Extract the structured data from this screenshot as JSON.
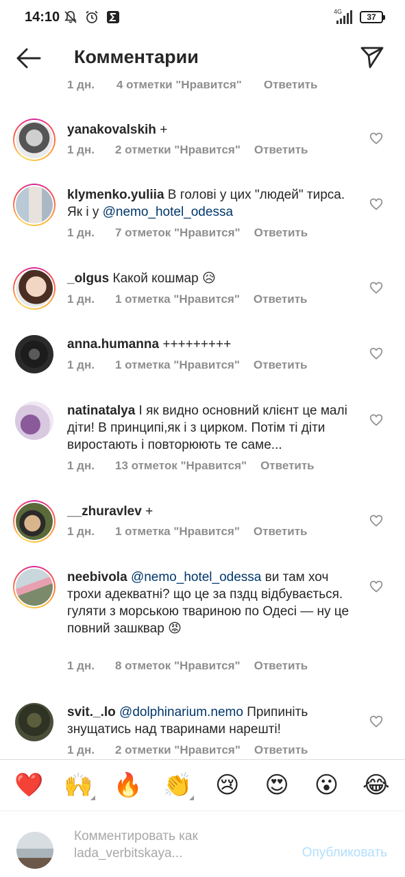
{
  "status_bar": {
    "time": "14:10",
    "network": "4G",
    "battery": "37"
  },
  "header": {
    "title": "Комментарии"
  },
  "partial_row": {
    "time": "1 дн.",
    "likes": "4 отметки \"Нравится\"",
    "reply": "Ответить"
  },
  "comments": [
    {
      "username": "yanakovalskih",
      "text_before": " +",
      "mention": "",
      "text_after": "",
      "time": "1 дн.",
      "likes": "2 отметки \"Нравится\"",
      "reply": "Ответить"
    },
    {
      "username": "klymenko.yuliia",
      "text_before": " В голові у цих \"людей\" тирса. Як і у ",
      "mention": "@nemo_hotel_odessa",
      "text_after": "",
      "time": "1 дн.",
      "likes": "7 отметок \"Нравится\"",
      "reply": "Ответить"
    },
    {
      "username": "_olgus",
      "text_before": " Какой кошмар 😥",
      "mention": "",
      "text_after": "",
      "time": "1 дн.",
      "likes": "1 отметка \"Нравится\"",
      "reply": "Ответить"
    },
    {
      "username": "anna.humanna",
      "text_before": " +++++++++",
      "mention": "",
      "text_after": "",
      "time": "1 дн.",
      "likes": "1 отметка \"Нравится\"",
      "reply": "Ответить"
    },
    {
      "username": "natinatalya",
      "text_before": " І як видно основний клієнт це малі діти! В принципі,як і з цирком. Потім ті діти виростають і повторюють те саме...",
      "mention": "",
      "text_after": "",
      "time": "1 дн.",
      "likes": "13 отметок \"Нравится\"",
      "reply": "Ответить"
    },
    {
      "username": "__zhuravlev",
      "text_before": " +",
      "mention": "",
      "text_after": "",
      "time": "1 дн.",
      "likes": "1 отметка \"Нравится\"",
      "reply": "Ответить"
    },
    {
      "username": "neebivola",
      "text_before": " ",
      "mention": "@nemo_hotel_odessa",
      "text_after": " ви там хоч трохи адекватні? що це за пздц відбувається. гуляти з морською твариною по Одесі — ну це повний зашквар 😡",
      "time": "1 дн.",
      "likes": "8 отметок \"Нравится\"",
      "reply": "Ответить"
    },
    {
      "username": "svit._.lo",
      "text_before": " ",
      "mention": "@dolphinarium.nemo",
      "text_after": "  Припиніть знущатись над тваринами нарешті!",
      "time": "1 дн.",
      "likes": "2 отметки \"Нравится\"",
      "reply": "Ответить"
    }
  ],
  "emoji_bar": [
    "❤️",
    "🙌",
    "🔥",
    "👏",
    "😢",
    "😍",
    "😮",
    "😂"
  ],
  "composer": {
    "placeholder": "Комментировать как lada_verbitskaya...",
    "publish_label": "Опубликовать"
  },
  "colors": {
    "mention": "#00376b",
    "meta": "#8e8e8e",
    "publish_disabled": "#b2dffc"
  }
}
